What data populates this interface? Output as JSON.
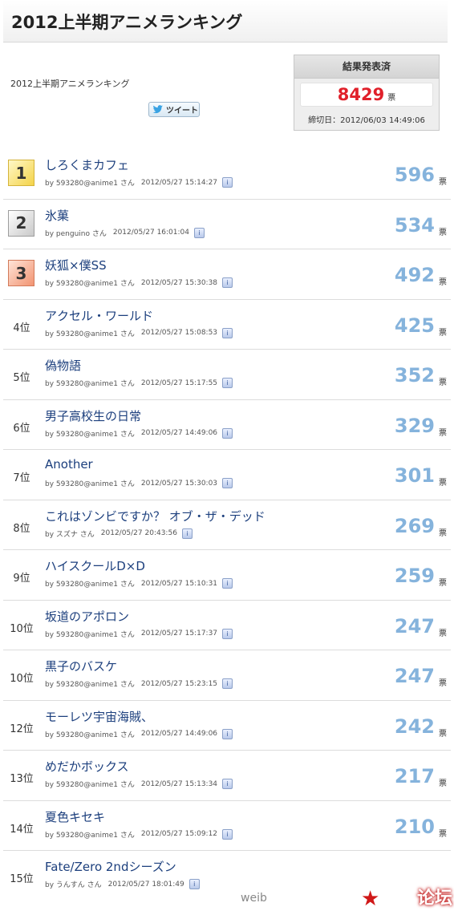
{
  "header": {
    "title": "2012上半期アニメランキング"
  },
  "subtitle": "2012上半期アニメランキング",
  "tweet_label": "ツイート",
  "result": {
    "title": "結果発表済",
    "total": "8429",
    "unit": "票",
    "deadline": "締切日：2012/06/03 14:49:06"
  },
  "rankings": [
    {
      "rank": "1",
      "medal": "gold",
      "title": "しろくまカフェ",
      "user": "by 593280@anime1 さん",
      "date": "2012/05/27 15:14:27",
      "votes": "596",
      "unit": "票"
    },
    {
      "rank": "2",
      "medal": "silver",
      "title": "氷菓",
      "user": "by penguino さん",
      "date": "2012/05/27 16:01:04",
      "votes": "534",
      "unit": "票"
    },
    {
      "rank": "3",
      "medal": "bronze",
      "title": "妖狐×僕SS",
      "user": "by 593280@anime1 さん",
      "date": "2012/05/27 15:30:38",
      "votes": "492",
      "unit": "票"
    },
    {
      "rank": "4位",
      "medal": "",
      "title": "アクセル・ワールド",
      "user": "by 593280@anime1 さん",
      "date": "2012/05/27 15:08:53",
      "votes": "425",
      "unit": "票"
    },
    {
      "rank": "5位",
      "medal": "",
      "title": "偽物語",
      "user": "by 593280@anime1 さん",
      "date": "2012/05/27 15:17:55",
      "votes": "352",
      "unit": "票"
    },
    {
      "rank": "6位",
      "medal": "",
      "title": "男子高校生の日常",
      "user": "by 593280@anime1 さん",
      "date": "2012/05/27 14:49:06",
      "votes": "329",
      "unit": "票"
    },
    {
      "rank": "7位",
      "medal": "",
      "title": "Another",
      "user": "by 593280@anime1 さん",
      "date": "2012/05/27 15:30:03",
      "votes": "301",
      "unit": "票"
    },
    {
      "rank": "8位",
      "medal": "",
      "title": "これはゾンビですか？ オブ・ザ・デッド",
      "user": "by スズナ さん",
      "date": "2012/05/27 20:43:56",
      "votes": "269",
      "unit": "票"
    },
    {
      "rank": "9位",
      "medal": "",
      "title": "ハイスクールD×D",
      "user": "by 593280@anime1 さん",
      "date": "2012/05/27 15:10:31",
      "votes": "259",
      "unit": "票"
    },
    {
      "rank": "10位",
      "medal": "",
      "title": "坂道のアポロン",
      "user": "by 593280@anime1 さん",
      "date": "2012/05/27 15:17:37",
      "votes": "247",
      "unit": "票"
    },
    {
      "rank": "10位",
      "medal": "",
      "title": "黒子のバスケ",
      "user": "by 593280@anime1 さん",
      "date": "2012/05/27 15:23:15",
      "votes": "247",
      "unit": "票"
    },
    {
      "rank": "12位",
      "medal": "",
      "title": "モーレツ宇宙海賊、",
      "user": "by 593280@anime1 さん",
      "date": "2012/05/27 14:49:06",
      "votes": "242",
      "unit": "票"
    },
    {
      "rank": "13位",
      "medal": "",
      "title": "めだかボックス",
      "user": "by 593280@anime1 さん",
      "date": "2012/05/27 15:13:34",
      "votes": "217",
      "unit": "票"
    },
    {
      "rank": "14位",
      "medal": "",
      "title": "夏色キセキ",
      "user": "by 593280@anime1 さん",
      "date": "2012/05/27 15:09:12",
      "votes": "210",
      "unit": "票"
    },
    {
      "rank": "15位",
      "medal": "",
      "title": "Fate/Zero 2ndシーズン",
      "user": "by うんすん さん",
      "date": "2012/05/27 18:01:49",
      "votes": "",
      "unit": ""
    }
  ],
  "watermark": {
    "text": "weib",
    "logo": "论坛"
  },
  "colors": {
    "title_link": "#1c3f7d",
    "votes": "#85b3dc",
    "total": "#e0202a"
  }
}
